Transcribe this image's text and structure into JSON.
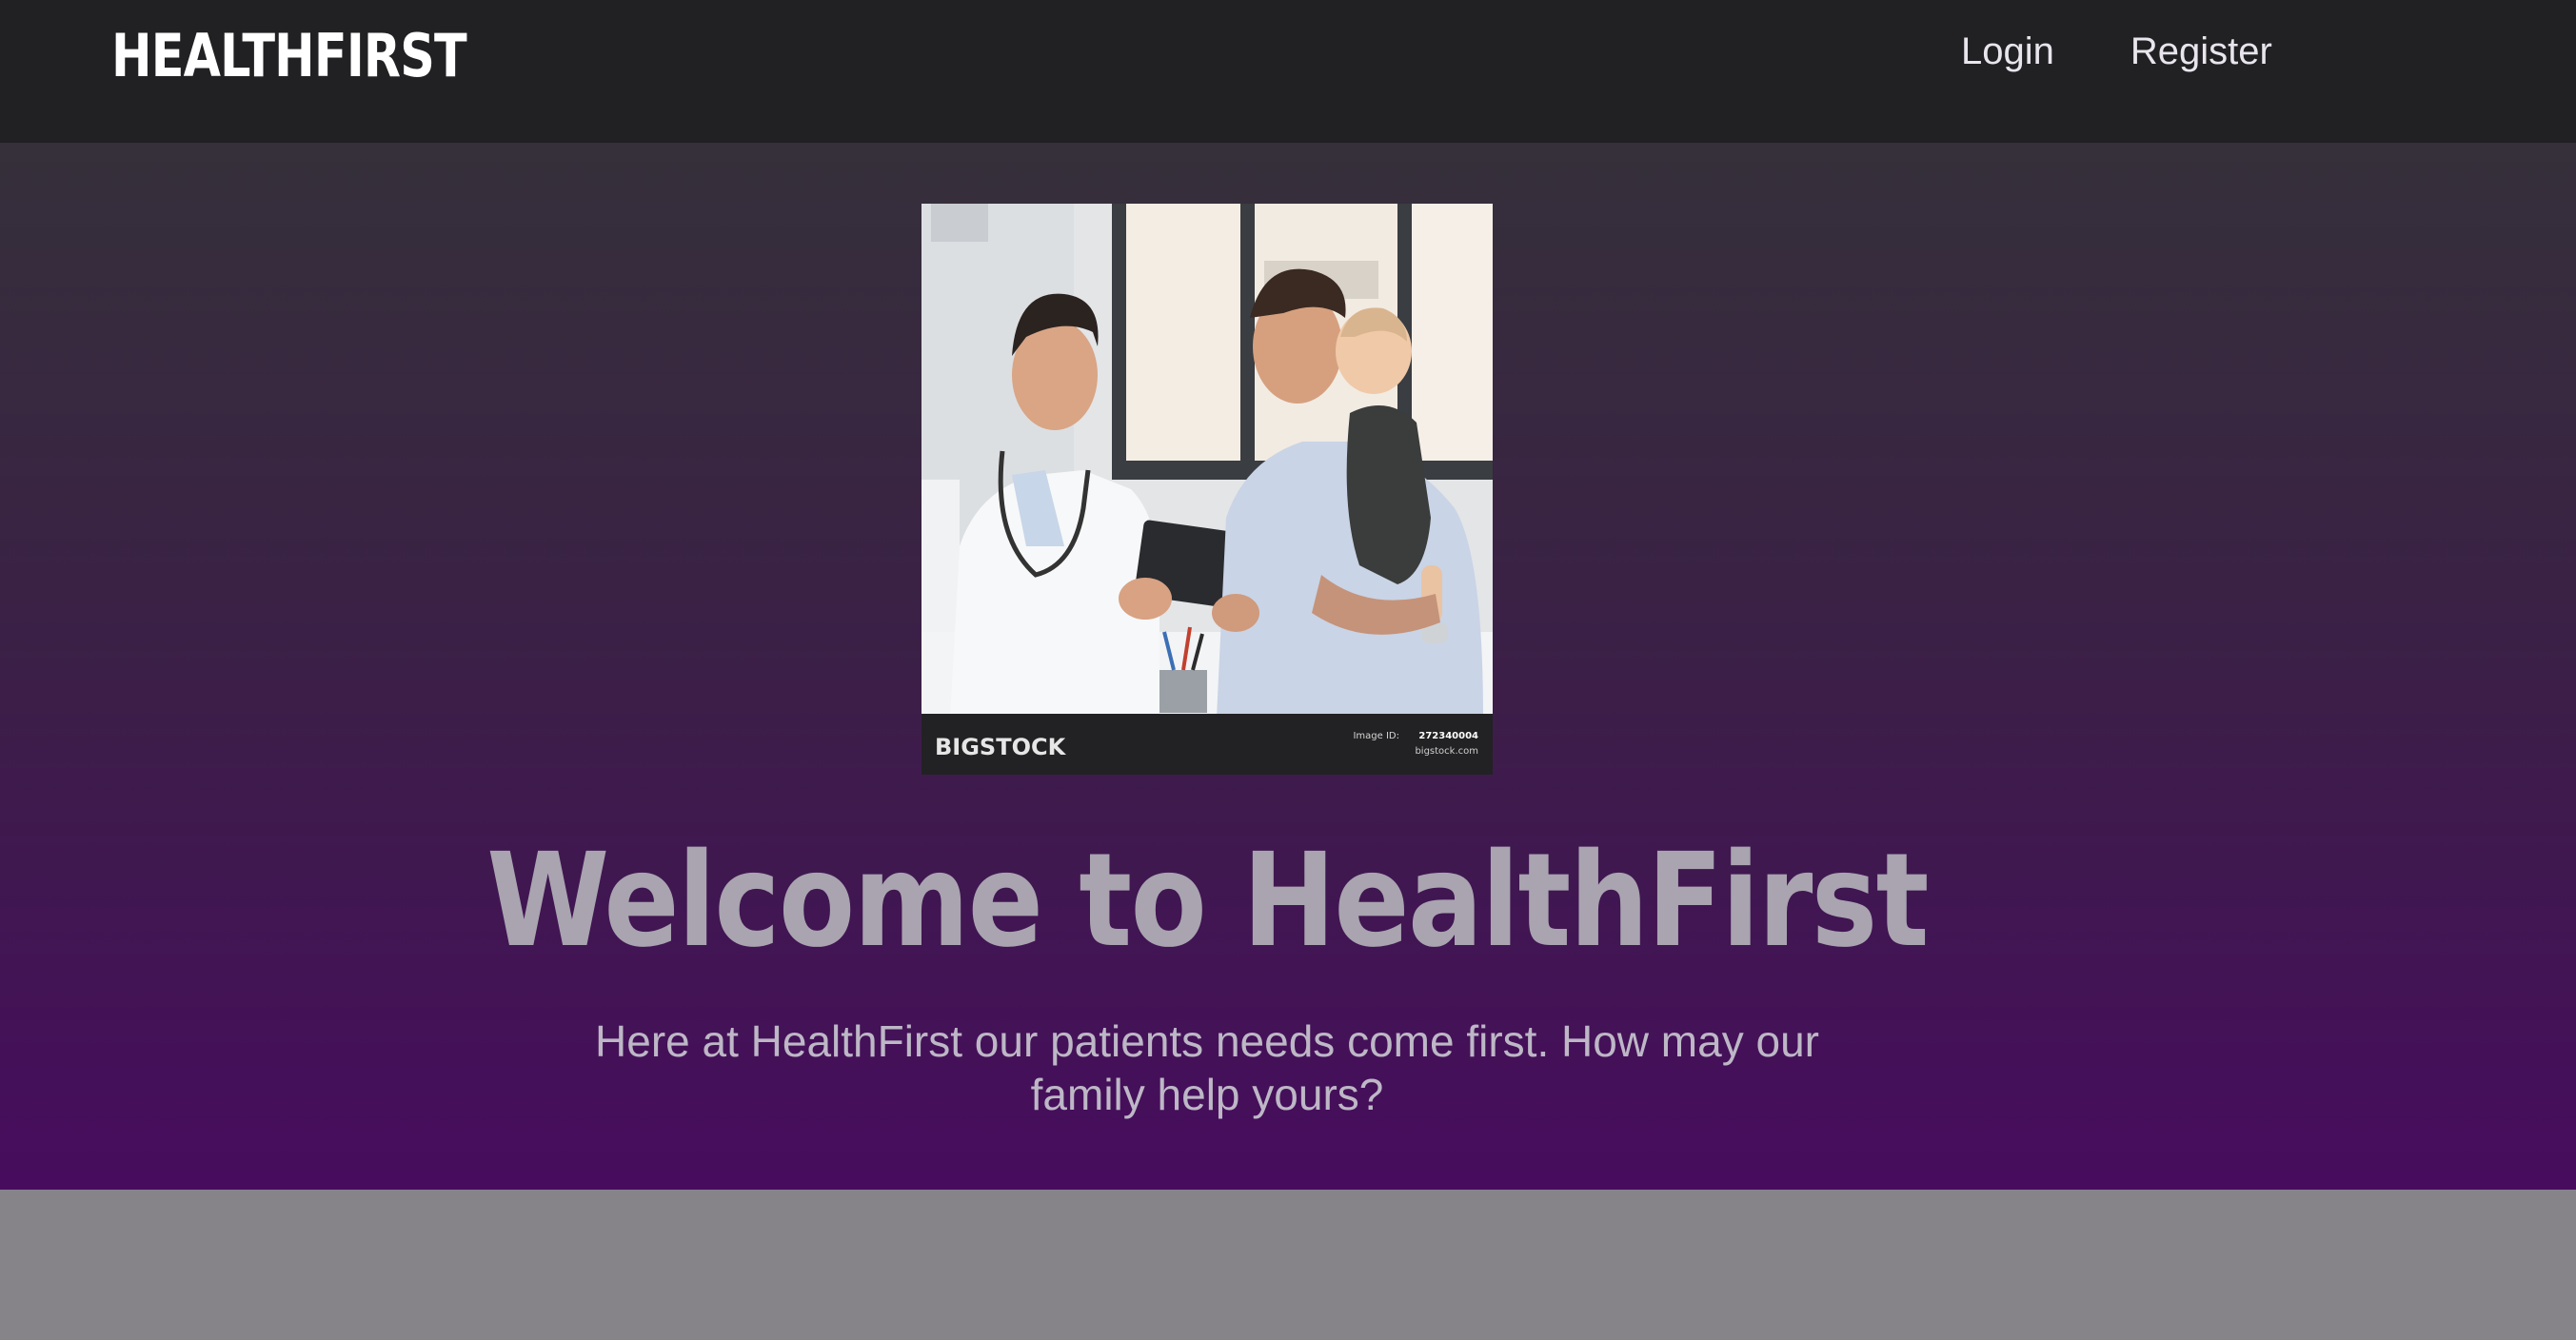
{
  "navbar": {
    "brand": "HEALTHFIRST",
    "links": {
      "login": "Login",
      "register": "Register"
    }
  },
  "hero": {
    "image": {
      "watermark_brand": "BIGSTOCK",
      "image_id_label": "Image ID:",
      "image_id": "272340004",
      "site": "bigstock.com"
    },
    "title": "Welcome to HealthFirst",
    "subtitle": "Here at HealthFirst our patients needs come first. How may our family help yours?"
  },
  "colors": {
    "navbar_bg": "#212023",
    "hero_gradient_top": "#35303a",
    "hero_gradient_bottom": "#470c5e",
    "title_color": "#a9a4b0",
    "footer_band": "#868389"
  }
}
